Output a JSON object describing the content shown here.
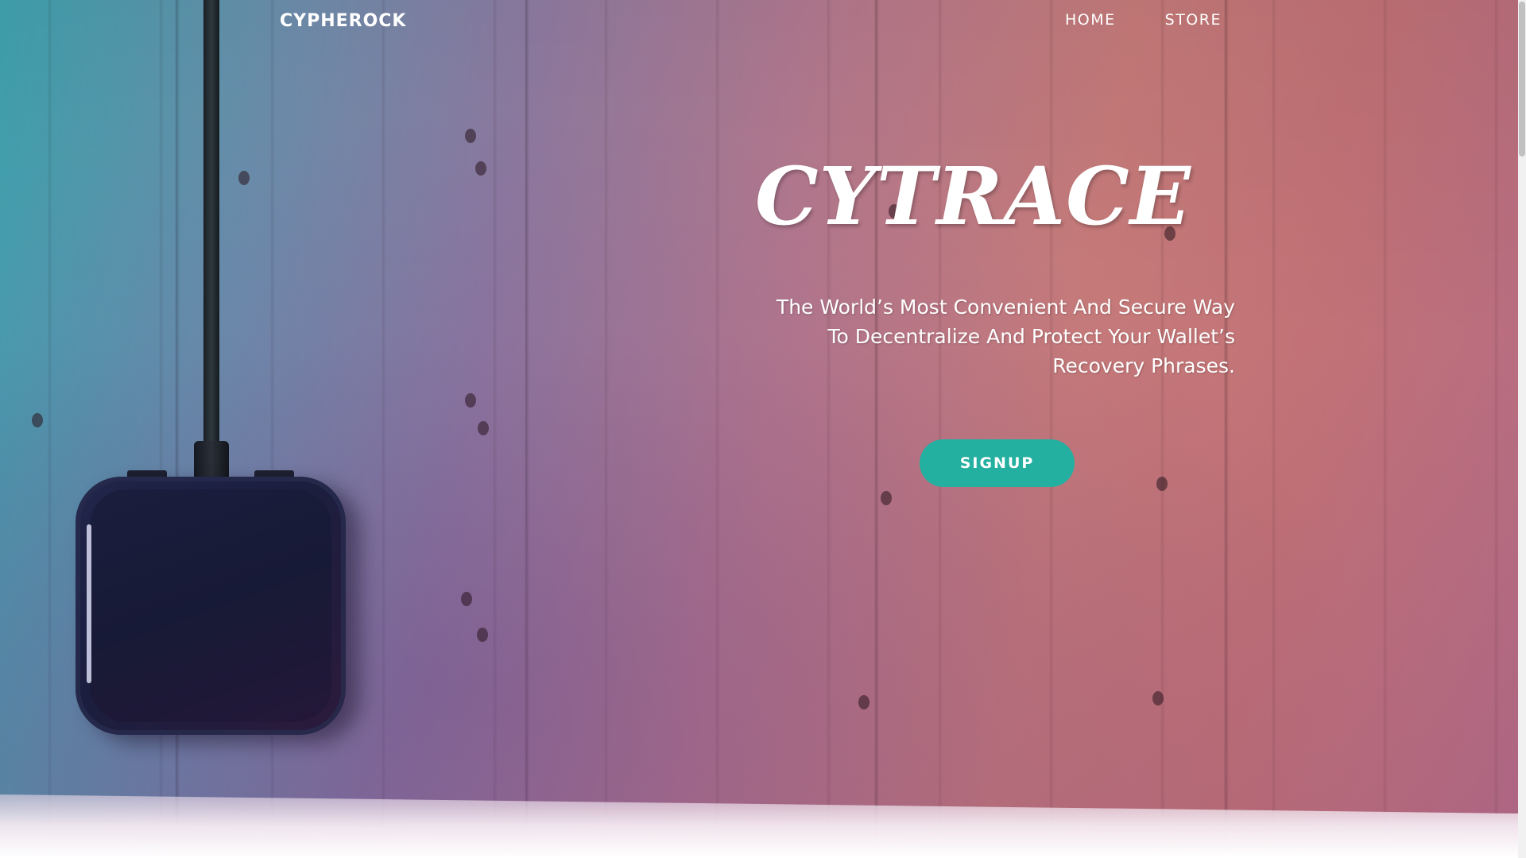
{
  "nav": {
    "logo": "CYPHEROCK",
    "links": [
      {
        "label": "HOME"
      },
      {
        "label": "STORE"
      }
    ]
  },
  "hero": {
    "title": "CYTRACE",
    "tagline_lines": [
      "The World’s Most Convenient And Secure Way",
      "To Decentralize And Protect Your Wallet’s",
      "Recovery Phrases."
    ],
    "cta_label": "SIGNUP"
  },
  "colors": {
    "accent": "#24b0a0",
    "text": "#ffffff",
    "bg_left": "#3fa4b0",
    "bg_right": "#c77b7a"
  },
  "icons": {
    "logo": "cypherock-wordmark"
  }
}
